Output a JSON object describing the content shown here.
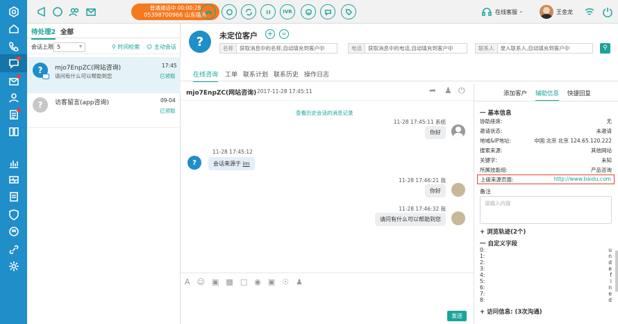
{
  "topbar": {
    "call_status": "普通通话中  00:00:28",
    "call_number": "05398700966 山东临沂",
    "ivr_label": "IVR",
    "status_label": "在线客服",
    "user_name": "王金龙"
  },
  "list": {
    "tab_pending": "待处理2",
    "tab_all": "全部",
    "session_limit_label": "会话上限",
    "session_limit_value": "5",
    "time_search": "时间检索",
    "active_session": "主动会话",
    "conversations": [
      {
        "title": "mjo7EnpZC(网站咨询)",
        "time": "17:45",
        "preview": "请问有什么可以帮助到您",
        "status": "已领取"
      },
      {
        "title": "访客留言(app咨询)",
        "time": "09-04",
        "preview": "",
        "status": "已领取"
      }
    ]
  },
  "customer": {
    "name": "未定位客户",
    "fields": [
      {
        "label": "名称",
        "placeholder": "获取消息中的名称,自动填充到客户中"
      },
      {
        "label": "电话",
        "placeholder": "获取消息中的电话,自动填充到客户中"
      },
      {
        "label": "联系人",
        "placeholder": "录入联系人,自动填充到客户中"
      }
    ]
  },
  "center_tabs": [
    "在线咨询",
    "工单",
    "联系计划",
    "联系历史",
    "操作日志"
  ],
  "chat": {
    "title": "mjo7EnpZC(网站咨询)",
    "date": "2017-11-28 17:45:11",
    "history_link": "查看历史会话的消息记录",
    "messages": [
      {
        "meta": "11-28 17:45:11 系统",
        "text": "你好"
      },
      {
        "meta": "11-28 17:45:12",
        "text": "会话来源于 ",
        "link": "im"
      },
      {
        "meta": "11-28 17:46:21 我",
        "text": "你好"
      },
      {
        "meta": "11-28 17:46:32 我",
        "text": "请问有什么可以帮助到您"
      }
    ],
    "send": "发送"
  },
  "right": {
    "tabs": [
      "添加客户",
      "辅助信息",
      "快捷回复"
    ],
    "basic_title": "一 基本信息",
    "info": [
      {
        "k": "协助座席:",
        "v": "无"
      },
      {
        "k": "邀请状态:",
        "v": "未邀请"
      },
      {
        "k": "地域&IP地址:",
        "v": "中国 北京 北京 124.65.120.222"
      },
      {
        "k": "搜索来源:",
        "v": "其他网站"
      },
      {
        "k": "关键字:",
        "v": "未知"
      },
      {
        "k": "所属技能组:",
        "v": "产品咨询"
      },
      {
        "k": "上级来源页面:",
        "v": "http://www.baidu.com"
      }
    ],
    "remark_label": "备注",
    "remark_placeholder": "请输入内容",
    "browse_title": "浏览轨迹(2个)",
    "custom_title": "一 自定义字段",
    "custom_fields": [
      {
        "k": "0:",
        "v": "u"
      },
      {
        "k": "1:",
        "v": "n"
      },
      {
        "k": "2:",
        "v": "d"
      },
      {
        "k": "3:",
        "v": "e"
      },
      {
        "k": "4:",
        "v": "f"
      },
      {
        "k": "5:",
        "v": "i"
      },
      {
        "k": "6:",
        "v": "n"
      },
      {
        "k": "7:",
        "v": "e"
      },
      {
        "k": "8:",
        "v": "d"
      }
    ],
    "visit_title": "访问信息: (3次沟通)"
  },
  "colors": {
    "accent": "#1aa39a",
    "rail": "#1f8ec9",
    "call": "#f57a1f",
    "highlight": "#e8412f"
  }
}
